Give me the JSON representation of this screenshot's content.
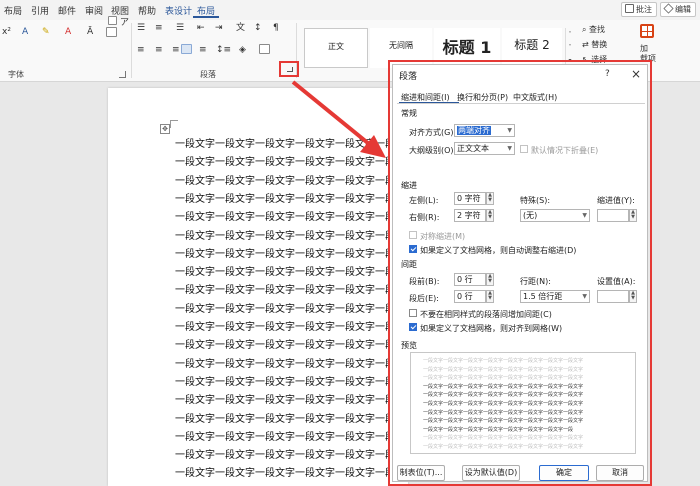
{
  "ribbon_tabs": [
    "布局",
    "引用",
    "邮件",
    "审阅",
    "视图",
    "帮助",
    "表设计",
    "布局"
  ],
  "top_right": {
    "comment_label": "批注",
    "edit_label": "编辑"
  },
  "ribbon": {
    "font_group_label": "字体",
    "paragraph_group_label": "段落",
    "styles": [
      "正文",
      "无间隔",
      "标题 1",
      "标题 2"
    ],
    "editing": [
      "查找",
      "替换",
      "选择"
    ],
    "addins_label": "加\n载项"
  },
  "document": {
    "line_text": "一段文字一段文字一段文字一段文字一段文字一段文字一段文字一段文字",
    "line_count": 19
  },
  "dialog": {
    "title": "段落",
    "help": "?",
    "close": "×",
    "tabs": [
      "缩进和间距(I)",
      "换行和分页(P)",
      "中文版式(H)"
    ],
    "general": {
      "header": "常规",
      "alignment_label": "对齐方式(G):",
      "alignment_value": "两端对齐",
      "outline_label": "大纲级别(O):",
      "outline_value": "正文文本",
      "collapsed_label": "默认情况下折叠(E)"
    },
    "indent": {
      "header": "缩进",
      "left_label": "左侧(L):",
      "left_value": "0 字符",
      "right_label": "右侧(R):",
      "right_value": "2 字符",
      "special_label": "特殊(S):",
      "special_value": "(无)",
      "by_label": "缩进值(Y):",
      "mirror_label": "对称缩进(M)",
      "auto_right_label": "如果定义了文档网格，则自动调整右缩进(D)"
    },
    "spacing": {
      "header": "间距",
      "before_label": "段前(B):",
      "before_value": "0 行",
      "after_label": "段后(E):",
      "after_value": "0 行",
      "line_spacing_label": "行距(N):",
      "line_spacing_value": "1.5 倍行距",
      "at_label": "设置值(A):",
      "no_space_label": "不要在相同样式的段落间增加间距(C)",
      "snap_grid_label": "如果定义了文档网格，则对齐到网格(W)"
    },
    "preview": {
      "header": "预览",
      "sample_text": "一段文字一段文字一段文字一段文字一段文字一段文字一段文字一段文字"
    },
    "buttons": {
      "tabs": "制表位(T)...",
      "default": "设为默认值(D)",
      "ok": "确定",
      "cancel": "取消"
    }
  }
}
